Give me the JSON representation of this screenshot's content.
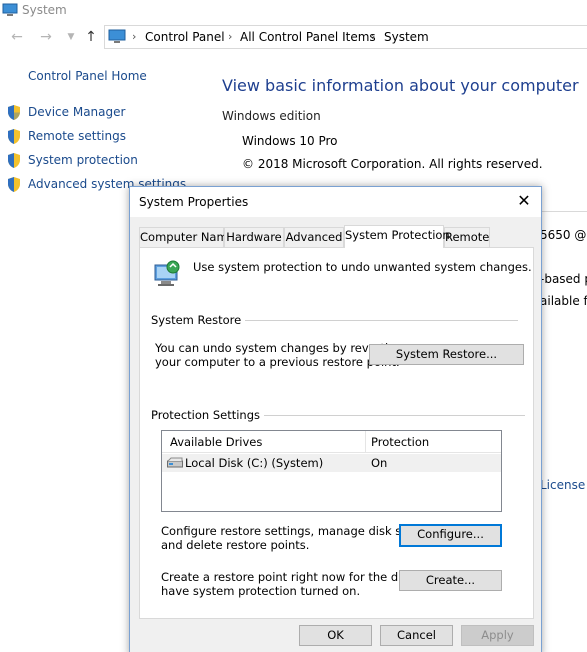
{
  "window": {
    "title": "System",
    "icon": "computer-icon"
  },
  "nav": {
    "back_icon": "arrow-left-icon",
    "forward_icon": "arrow-right-icon",
    "recent_icon": "chevron-down-icon",
    "up_icon": "arrow-up-icon",
    "breadcrumbs": [
      "Control Panel",
      "All Control Panel Items",
      "System"
    ]
  },
  "sidebar": {
    "home": "Control Panel Home",
    "links": [
      {
        "label": "Device Manager",
        "icon": "shield-icon"
      },
      {
        "label": "Remote settings",
        "icon": "shield-icon"
      },
      {
        "label": "System protection",
        "icon": "shield-icon"
      },
      {
        "label": "Advanced system settings",
        "icon": "shield-icon"
      }
    ]
  },
  "main": {
    "heading": "View basic information about your computer",
    "edition_title": "Windows edition",
    "edition": "Windows 10 Pro",
    "copyright": "© 2018 Microsoft Corporation. All rights reserved.",
    "partial_text": [
      "5650 @",
      "-based p",
      "ailable fo",
      "License T"
    ]
  },
  "dialog": {
    "title": "System Properties",
    "tabs": [
      "Computer Name",
      "Hardware",
      "Advanced",
      "System Protection",
      "Remote"
    ],
    "active_tab": "System Protection",
    "intro": "Use system protection to undo unwanted system changes.",
    "restore": {
      "group": "System Restore",
      "desc_1": "You can undo system changes by reverting",
      "desc_2": "your computer to a previous restore point.",
      "button": "System Restore..."
    },
    "protection": {
      "group": "Protection Settings",
      "columns": [
        "Available Drives",
        "Protection"
      ],
      "rows": [
        {
          "drive": "Local Disk (C:) (System)",
          "protection": "On"
        }
      ],
      "configure_desc_1": "Configure restore settings, manage disk space,",
      "configure_desc_2": "and delete restore points.",
      "configure_button": "Configure...",
      "create_desc_1": "Create a restore point right now for the drives that",
      "create_desc_2": "have system protection turned on.",
      "create_button": "Create..."
    },
    "footer": {
      "ok": "OK",
      "cancel": "Cancel",
      "apply": "Apply"
    }
  }
}
